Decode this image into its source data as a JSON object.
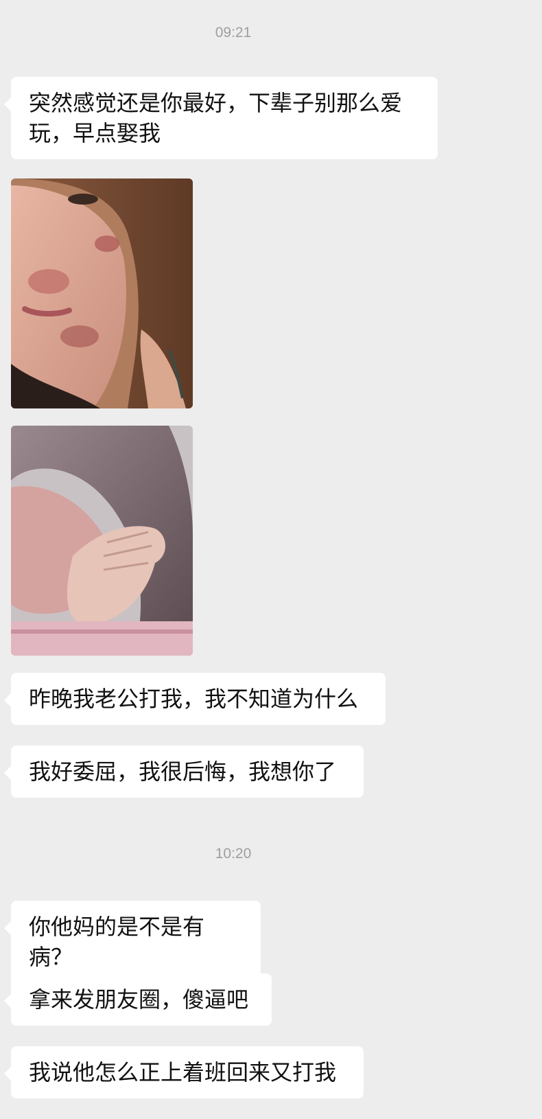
{
  "chat": {
    "timestamps": [
      "09:21",
      "10:20"
    ],
    "messages": [
      {
        "type": "text",
        "text": "突然感觉还是你最好，下辈子别那么爱玩，早点娶我"
      },
      {
        "type": "image",
        "icon": "photo-selfie-with-facial-bruises"
      },
      {
        "type": "image",
        "icon": "photo-woman-covering-face"
      },
      {
        "type": "text",
        "text": "昨晚我老公打我，我不知道为什么"
      },
      {
        "type": "text",
        "text": "我好委屈，我很后悔，我想你了"
      },
      {
        "type": "text",
        "text": "你他妈的是不是有病？"
      },
      {
        "type": "text",
        "text": "拿来发朋友圈，傻逼吧"
      },
      {
        "type": "text",
        "text": "我说他怎么正上着班回来又打我"
      }
    ]
  },
  "colors": {
    "background": "#ededed",
    "bubble": "#ffffff",
    "timestamp": "#9e9e9e"
  }
}
